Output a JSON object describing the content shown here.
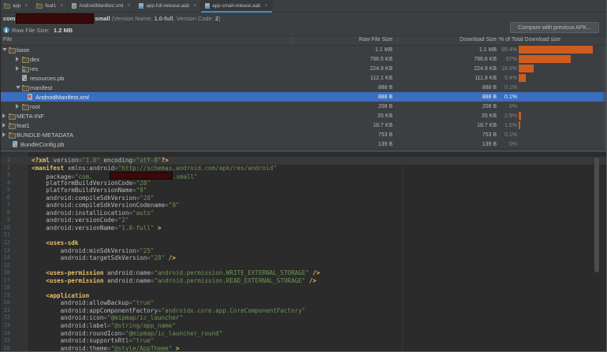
{
  "colors": {
    "accent": "#4A88C8",
    "sel": "#3B6EBE",
    "bar": "#CE5B1F",
    "tag": "#E8BF6A",
    "attr": "#BABABA",
    "eq": "#8A8A8A",
    "str": "#6E9456",
    "redact": "#3A0A0A"
  },
  "ui": {
    "close_glyph": "×"
  },
  "tabs": [
    {
      "label": "app",
      "icon": "module",
      "selected": false
    },
    {
      "label": "feat1",
      "icon": "module",
      "selected": false
    },
    {
      "label": "AndroidManifest.xml",
      "icon": "manifest",
      "selected": false
    },
    {
      "label": "app-full-release.aab",
      "icon": "aab",
      "selected": false
    },
    {
      "label": "app-small-release.aab",
      "icon": "aab",
      "selected": true
    }
  ],
  "info": {
    "package_prefix": "com",
    "package_suffix": "small",
    "meta_pre": " (Version Name: ",
    "version_name": "1.0-full",
    "meta_mid": ", Version Code: ",
    "version_code": "2",
    "meta_post": ")",
    "raw_size_label": "Raw File Size: ",
    "raw_size_value": "1.2 MB",
    "compare_button": "Compare with previous APK..."
  },
  "table": {
    "columns": [
      "File",
      "Raw File Size",
      "Download Size",
      "% of Total Download size"
    ],
    "rows": [
      {
        "name": "base",
        "raw": "1.1 MB",
        "dl": "1.1 MB",
        "pct": "95.4%",
        "bar": 95.4,
        "level": 0,
        "arrow": "down",
        "icon": "folder",
        "selected": false
      },
      {
        "name": "dex",
        "raw": "796.5 KB",
        "dl": "796.6 KB",
        "pct": "67%",
        "bar": 67,
        "level": 1,
        "arrow": "right",
        "icon": "folder",
        "selected": false
      },
      {
        "name": "res",
        "raw": "224.9 KB",
        "dl": "224.9 KB",
        "pct": "18.9%",
        "bar": 18.9,
        "level": 1,
        "arrow": "right",
        "icon": "res",
        "selected": false
      },
      {
        "name": "resources.pb",
        "raw": "112.1 KB",
        "dl": "111.8 KB",
        "pct": "9.4%",
        "bar": 9.4,
        "level": 1,
        "arrow": null,
        "icon": "pb",
        "selected": false
      },
      {
        "name": "manifest",
        "raw": "888 B",
        "dl": "888 B",
        "pct": "0.1%",
        "bar": 0.1,
        "level": 1,
        "arrow": "down",
        "icon": "folder",
        "selected": false
      },
      {
        "name": "AndroidManifest.xml",
        "raw": "888 B",
        "dl": "888 B",
        "pct": "0.1%",
        "bar": 0.1,
        "level": 2,
        "arrow": null,
        "icon": "manifest",
        "selected": true
      },
      {
        "name": "root",
        "raw": "208 B",
        "dl": "208 B",
        "pct": "0%",
        "bar": 0,
        "level": 1,
        "arrow": "right",
        "icon": "folder",
        "selected": false
      },
      {
        "name": "META-INF",
        "raw": "35 KB",
        "dl": "35 KB",
        "pct": "2.9%",
        "bar": 2.9,
        "level": 0,
        "arrow": "right",
        "icon": "folder",
        "selected": false
      },
      {
        "name": "feat1",
        "raw": "18.7 KB",
        "dl": "18.7 KB",
        "pct": "1.6%",
        "bar": 1.6,
        "level": 0,
        "arrow": "right",
        "icon": "folder",
        "selected": false
      },
      {
        "name": "BUNDLE-METADATA",
        "raw": "753 B",
        "dl": "753 B",
        "pct": "0.1%",
        "bar": 0.1,
        "level": 0,
        "arrow": "right",
        "icon": "folder",
        "selected": false
      },
      {
        "name": "BundleConfig.pb",
        "raw": "139 B",
        "dl": "139 B",
        "pct": "0%",
        "bar": 0,
        "level": 0,
        "arrow": null,
        "icon": "pb",
        "selected": false
      }
    ]
  },
  "editor": {
    "lines": [
      {
        "segs": [
          [
            "tg",
            "<?xml "
          ],
          [
            "at",
            "version"
          ],
          [
            "eq",
            "="
          ],
          [
            "st",
            "\"1.0\""
          ],
          [
            "pl",
            " "
          ],
          [
            "at",
            "encoding"
          ],
          [
            "eq",
            "="
          ],
          [
            "st",
            "\"utf-8\""
          ],
          [
            "tg",
            "?>"
          ]
        ]
      },
      {
        "segs": [
          [
            "tg",
            "<manifest "
          ],
          [
            "at",
            "xmlns:android"
          ],
          [
            "eq",
            "="
          ],
          [
            "st",
            "\"http://schemas.android.com/apk/res/android\""
          ]
        ]
      },
      {
        "segs": [
          [
            "pl",
            "    "
          ],
          [
            "at",
            "package"
          ],
          [
            "eq",
            "="
          ],
          [
            "st",
            "\"com."
          ],
          [
            "RB",
            ""
          ],
          [
            "st",
            ".small\""
          ]
        ]
      },
      {
        "segs": [
          [
            "pl",
            "    "
          ],
          [
            "at",
            "platformBuildVersionCode"
          ],
          [
            "eq",
            "="
          ],
          [
            "st",
            "\"28\""
          ]
        ]
      },
      {
        "segs": [
          [
            "pl",
            "    "
          ],
          [
            "at",
            "platformBuildVersionName"
          ],
          [
            "eq",
            "="
          ],
          [
            "st",
            "\"9\""
          ]
        ]
      },
      {
        "segs": [
          [
            "pl",
            "    "
          ],
          [
            "at",
            "android:compileSdkVersion"
          ],
          [
            "eq",
            "="
          ],
          [
            "st",
            "\"28\""
          ]
        ]
      },
      {
        "segs": [
          [
            "pl",
            "    "
          ],
          [
            "at",
            "android:compileSdkVersionCodename"
          ],
          [
            "eq",
            "="
          ],
          [
            "st",
            "\"9\""
          ]
        ]
      },
      {
        "segs": [
          [
            "pl",
            "    "
          ],
          [
            "at",
            "android:installLocation"
          ],
          [
            "eq",
            "="
          ],
          [
            "st",
            "\"auto\""
          ]
        ]
      },
      {
        "segs": [
          [
            "pl",
            "    "
          ],
          [
            "at",
            "android:versionCode"
          ],
          [
            "eq",
            "="
          ],
          [
            "st",
            "\"2\""
          ]
        ]
      },
      {
        "segs": [
          [
            "pl",
            "    "
          ],
          [
            "at",
            "android:versionName"
          ],
          [
            "eq",
            "="
          ],
          [
            "st",
            "\"1.0-full\""
          ],
          [
            "tg",
            " >"
          ]
        ]
      },
      {
        "segs": []
      },
      {
        "segs": [
          [
            "pl",
            "    "
          ],
          [
            "tg",
            "<uses-sdk"
          ]
        ]
      },
      {
        "segs": [
          [
            "pl",
            "        "
          ],
          [
            "at",
            "android:minSdkVersion"
          ],
          [
            "eq",
            "="
          ],
          [
            "st",
            "\"25\""
          ]
        ]
      },
      {
        "segs": [
          [
            "pl",
            "        "
          ],
          [
            "at",
            "android:targetSdkVersion"
          ],
          [
            "eq",
            "="
          ],
          [
            "st",
            "\"28\""
          ],
          [
            "tg",
            " />"
          ]
        ]
      },
      {
        "segs": []
      },
      {
        "segs": [
          [
            "pl",
            "    "
          ],
          [
            "tg",
            "<uses-permission "
          ],
          [
            "at",
            "android:name"
          ],
          [
            "eq",
            "="
          ],
          [
            "st",
            "\"android.permission.WRITE_EXTERNAL_STORAGE\""
          ],
          [
            "tg",
            " />"
          ]
        ]
      },
      {
        "segs": [
          [
            "pl",
            "    "
          ],
          [
            "tg",
            "<uses-permission "
          ],
          [
            "at",
            "android:name"
          ],
          [
            "eq",
            "="
          ],
          [
            "st",
            "\"android.permission.READ_EXTERNAL_STORAGE\""
          ],
          [
            "tg",
            " />"
          ]
        ]
      },
      {
        "segs": []
      },
      {
        "segs": [
          [
            "pl",
            "    "
          ],
          [
            "tg",
            "<application"
          ]
        ]
      },
      {
        "segs": [
          [
            "pl",
            "        "
          ],
          [
            "at",
            "android:allowBackup"
          ],
          [
            "eq",
            "="
          ],
          [
            "st",
            "\"true\""
          ]
        ]
      },
      {
        "segs": [
          [
            "pl",
            "        "
          ],
          [
            "at",
            "android:appComponentFactory"
          ],
          [
            "eq",
            "="
          ],
          [
            "st",
            "\"androidx.core.app.CoreComponentFactory\""
          ]
        ]
      },
      {
        "segs": [
          [
            "pl",
            "        "
          ],
          [
            "at",
            "android:icon"
          ],
          [
            "eq",
            "="
          ],
          [
            "st",
            "\"@mipmap/ic_launcher\""
          ]
        ]
      },
      {
        "segs": [
          [
            "pl",
            "        "
          ],
          [
            "at",
            "android:label"
          ],
          [
            "eq",
            "="
          ],
          [
            "st",
            "\"@string/app_name\""
          ]
        ]
      },
      {
        "segs": [
          [
            "pl",
            "        "
          ],
          [
            "at",
            "android:roundIcon"
          ],
          [
            "eq",
            "="
          ],
          [
            "st",
            "\"@mipmap/ic_launcher_round\""
          ]
        ]
      },
      {
        "segs": [
          [
            "pl",
            "        "
          ],
          [
            "at",
            "android:supportsRtl"
          ],
          [
            "eq",
            "="
          ],
          [
            "st",
            "\"true\""
          ]
        ]
      },
      {
        "segs": [
          [
            "pl",
            "        "
          ],
          [
            "at",
            "android:theme"
          ],
          [
            "eq",
            "="
          ],
          [
            "st",
            "\"@style/AppTheme\""
          ],
          [
            "tg",
            " >"
          ]
        ]
      }
    ]
  }
}
